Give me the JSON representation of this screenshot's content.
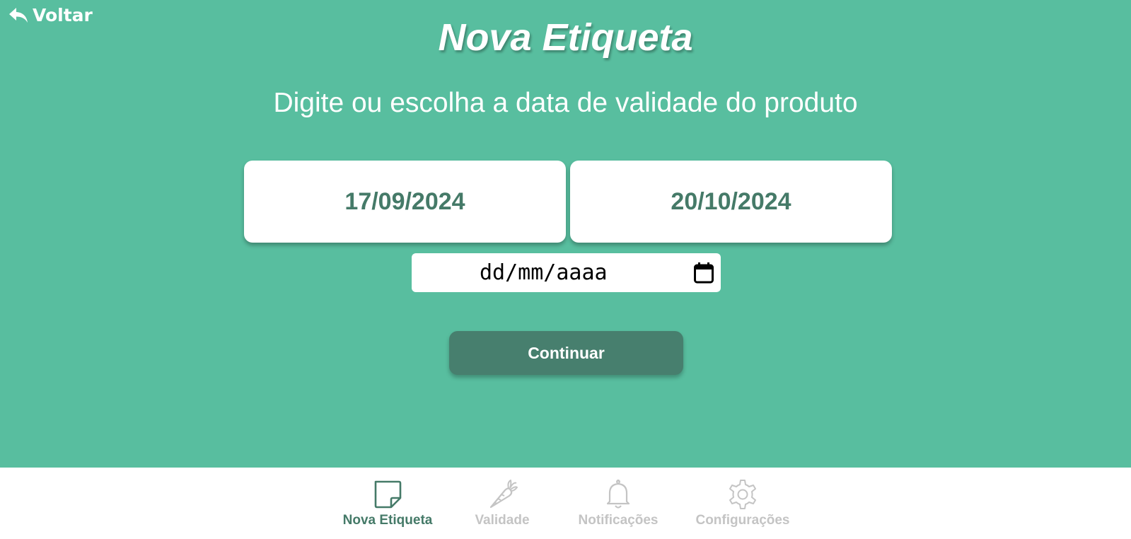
{
  "header": {
    "back_label": "Voltar",
    "title": "Nova Etiqueta",
    "subtitle": "Digite ou escolha a data de validade do produto"
  },
  "date_options": [
    {
      "label": "17/09/2024"
    },
    {
      "label": "20/10/2024"
    }
  ],
  "date_input": {
    "placeholder": "dd/mm/aaaa",
    "icon": "calendar-icon"
  },
  "continue_label": "Continuar",
  "bottom_nav": [
    {
      "label": "Nova Etiqueta",
      "icon": "sticky-note-icon",
      "active": true
    },
    {
      "label": "Validade",
      "icon": "carrot-icon",
      "active": false
    },
    {
      "label": "Notificações",
      "icon": "bell-icon",
      "active": false
    },
    {
      "label": "Configurações",
      "icon": "gear-icon",
      "active": false
    }
  ],
  "colors": {
    "background": "#58be9f",
    "accent": "#457a68",
    "button": "#477f6e",
    "inactive": "#c4c4c4",
    "white": "#ffffff"
  }
}
